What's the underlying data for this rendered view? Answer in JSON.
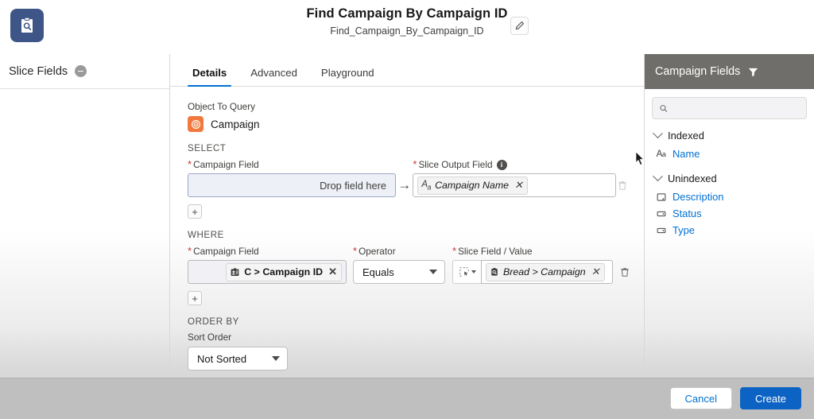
{
  "header": {
    "app_icon": "clipboard-search-icon",
    "title": "Find Campaign By Campaign ID",
    "subtitle": "Find_Campaign_By_Campaign_ID",
    "edit_icon": "pencil-icon"
  },
  "left_panel": {
    "title": "Slice Fields",
    "collapse_icon": "minus-circle-icon"
  },
  "center": {
    "tabs": [
      {
        "label": "Details",
        "active": true
      },
      {
        "label": "Advanced",
        "active": false
      },
      {
        "label": "Playground",
        "active": false
      }
    ],
    "object_to_query": {
      "label": "Object To Query",
      "icon": "campaign-target-icon",
      "value": "Campaign"
    },
    "select": {
      "section": "SELECT",
      "field_label": "Campaign Field",
      "dropzone_text": "Drop field here",
      "arrow": "→",
      "output_label": "Slice Output Field",
      "info_icon": "info-icon",
      "output_chip": {
        "icon": "text-field-icon",
        "text": "Campaign Name",
        "remove": "✕"
      },
      "trash_icon": "trash-icon",
      "add_label": "+"
    },
    "where": {
      "section": "WHERE",
      "field_label": "Campaign Field",
      "field_chip": {
        "icon": "id-badge-icon",
        "text": "C > Campaign ID",
        "remove": "✕"
      },
      "operator_label": "Operator",
      "operator_value": "Equals",
      "value_label": "Slice Field / Value",
      "value_picker_icon": "drag-select-icon",
      "value_chip": {
        "icon": "clipboard-search-icon",
        "text": "Bread > Campaign",
        "remove": "✕"
      },
      "trash_icon": "trash-icon",
      "add_label": "+"
    },
    "order_by": {
      "section": "ORDER BY",
      "sort_label": "Sort Order",
      "sort_value": "Not Sorted"
    }
  },
  "right_panel": {
    "title": "Campaign Fields",
    "filter_icon": "funnel-icon",
    "search": {
      "value": "",
      "placeholder": "",
      "icon": "search-icon"
    },
    "groups": [
      {
        "label": "Indexed",
        "items": [
          {
            "label": "Name",
            "icon": "text-field-icon"
          }
        ]
      },
      {
        "label": "Unindexed",
        "items": [
          {
            "label": "Description",
            "icon": "textarea-field-icon"
          },
          {
            "label": "Status",
            "icon": "picklist-field-icon"
          },
          {
            "label": "Type",
            "icon": "picklist-field-icon"
          }
        ]
      }
    ]
  },
  "footer": {
    "cancel_label": "Cancel",
    "create_label": "Create"
  },
  "colors": {
    "accent_blue": "#0070d2",
    "primary_button": "#0c63c4",
    "required_red": "#c23934",
    "campaign_orange": "#f2793e",
    "panel_header_gray": "#706e6b",
    "app_icon_navy": "#3d5687"
  }
}
